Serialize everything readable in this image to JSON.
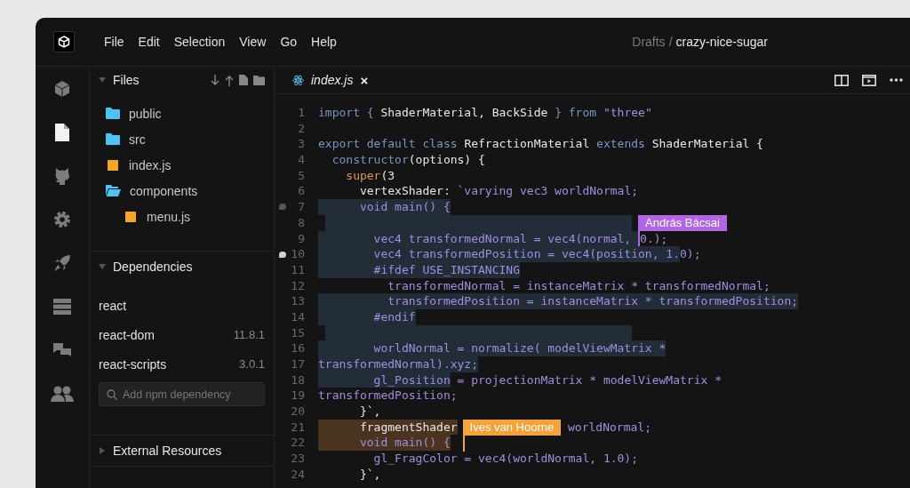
{
  "menu": [
    {
      "label": "File"
    },
    {
      "label": "Edit"
    },
    {
      "label": "Selection"
    },
    {
      "label": "View"
    },
    {
      "label": "Go"
    },
    {
      "label": "Help"
    }
  ],
  "breadcrumb": {
    "folder": "Drafts",
    "separator": "/",
    "project": "crazy-nice-sugar"
  },
  "activity_bar": [
    {
      "kind": "cube",
      "selected": false
    },
    {
      "kind": "file",
      "selected": true
    },
    {
      "kind": "github",
      "selected": false
    },
    {
      "kind": "gear",
      "selected": false
    },
    {
      "kind": "rocket",
      "selected": false
    },
    {
      "kind": "server",
      "selected": false
    },
    {
      "kind": "chat",
      "selected": false
    },
    {
      "kind": "people",
      "selected": false
    }
  ],
  "sidebar": {
    "files": {
      "title": "Files",
      "expanded": true,
      "items": [
        {
          "name": "public",
          "kind": "folder",
          "expanded": false
        },
        {
          "name": "src",
          "kind": "folder",
          "expanded": false
        },
        {
          "name": "index.js",
          "kind": "js"
        },
        {
          "name": "components",
          "kind": "folder",
          "expanded": true,
          "children": [
            {
              "name": "menu.js",
              "kind": "js"
            }
          ]
        }
      ]
    },
    "dependencies": {
      "title": "Dependencies",
      "expanded": true,
      "items": [
        {
          "name": "react"
        },
        {
          "name": "react-dom",
          "version": "11.8.1"
        },
        {
          "name": "react-scripts",
          "version": "3.0.1"
        }
      ],
      "search": {
        "placeholder": "Add npm dependency"
      }
    },
    "external_resources": {
      "title": "External Resources",
      "expanded": false
    }
  },
  "tab": {
    "label": "index.js",
    "close": "×"
  },
  "code": {
    "lines": [
      {
        "n": "1",
        "tokens": [
          {
            "t": "import { ",
            "kind": "kw"
          },
          {
            "t": "ShaderMaterial, BackSide ",
            "kind": "id"
          },
          {
            "t": "} from ",
            "kind": "kw"
          },
          {
            "t": "\"three\"",
            "kind": "str"
          }
        ]
      },
      {
        "n": "2"
      },
      {
        "n": "3",
        "tokens": [
          {
            "t": "export default class ",
            "kind": "kw"
          },
          {
            "t": "RefractionMaterial ",
            "kind": "id"
          },
          {
            "t": "extends ",
            "kind": "kw"
          },
          {
            "t": "ShaderMaterial {",
            "kind": "id"
          }
        ]
      },
      {
        "n": "4",
        "tokens": [
          {
            "t": "  constructor",
            "kind": "kw"
          },
          {
            "t": "(options) {",
            "kind": "id"
          }
        ]
      },
      {
        "n": "5",
        "tokens": [
          {
            "t": "    super",
            "kind": "fn"
          },
          {
            "t": "(3",
            "kind": "id"
          }
        ]
      },
      {
        "n": "6",
        "tokens": [
          {
            "t": "      vertexShader: ",
            "kind": "id"
          },
          {
            "t": "`varying vec3 worldNormal;",
            "kind": "str"
          }
        ]
      },
      {
        "n": "7",
        "color": "#222d37",
        "comment": {
          "unread": false
        },
        "tokens": [
          {
            "t": "      void main() {",
            "kind": "str",
            "selected": true
          }
        ]
      },
      {
        "n": "8",
        "color": "#222d37"
      },
      {
        "n": "9",
        "color": "#222d37",
        "tokens": [
          {
            "t": "        vec4 transformedNormal = vec4(normal, ",
            "kind": "str",
            "selected": true
          },
          {
            "kind": "caret",
            "name": "András Bácsai",
            "color": "#b266e6"
          },
          {
            "t": "0.);",
            "kind": "str",
            "selected": false
          }
        ]
      },
      {
        "n": "10",
        "color": "#222d37",
        "comment": {
          "unread": true
        },
        "tokens": [
          {
            "t": "        vec4 transformedPosition = vec4(position, 1.",
            "kind": "str",
            "selected": true
          },
          {
            "t": "0);",
            "kind": "str",
            "selected": false
          }
        ]
      },
      {
        "n": "11",
        "color": "#222d37",
        "tokens": [
          {
            "t": "        #ifdef USE_INSTANCING",
            "kind": "str",
            "selected": true
          }
        ]
      },
      {
        "n": "12",
        "tokens": [
          {
            "t": "          transformedNormal = instanceMatrix * transformedNormal;",
            "kind": "str"
          }
        ]
      },
      {
        "n": "13",
        "color": "#222d37",
        "tokens": [
          {
            "t": "          transformedPosition = instanceMatrix * transformedPosition;",
            "kind": "str",
            "selected": true
          }
        ]
      },
      {
        "n": "14",
        "color": "#222d37",
        "tokens": [
          {
            "t": "        #endif",
            "kind": "str",
            "selected": true
          }
        ]
      },
      {
        "n": "15",
        "color": "#222d37"
      },
      {
        "n": "16",
        "color": "#222d37",
        "tokens": [
          {
            "t": "        worldNormal = normalize( modelViewMatrix *",
            "kind": "str",
            "selected": true
          }
        ]
      },
      {
        "n": "17",
        "color": "#222d37",
        "tokens": [
          {
            "t": "transformedNormal).xyz;",
            "kind": "str",
            "selected": true
          }
        ]
      },
      {
        "n": "18",
        "color": "#222d37",
        "tokens": [
          {
            "t": "        gl_Position",
            "kind": "str",
            "selected": true
          },
          {
            "t": " = projectionMatrix * modelViewMatrix *",
            "kind": "str",
            "selected": false
          }
        ]
      },
      {
        "n": "19",
        "tokens": [
          {
            "t": "transformedPosition;",
            "kind": "str"
          }
        ]
      },
      {
        "n": "20",
        "tokens": [
          {
            "t": "      }`,",
            "kind": "id"
          }
        ]
      },
      {
        "n": "21",
        "color": "#4a3420",
        "tokens": [
          {
            "t": "      fragmentShader",
            "kind": "id",
            "selected": true
          },
          {
            "kind": "flag",
            "name": "Ives van Hoorne",
            "color": "#f5a23a"
          },
          {
            "t": " worldNormal;",
            "kind": "str",
            "selected": false
          }
        ]
      },
      {
        "n": "22",
        "color": "#4a3420",
        "tokens": [
          {
            "t": "      void main() {",
            "kind": "str",
            "selected": true
          }
        ]
      },
      {
        "n": "23",
        "tokens": [
          {
            "t": "        gl_FragColor = vec4(worldNormal, 1.0);",
            "kind": "str"
          }
        ]
      },
      {
        "n": "24",
        "tokens": [
          {
            "t": "      }`,",
            "kind": "id"
          }
        ]
      }
    ]
  }
}
